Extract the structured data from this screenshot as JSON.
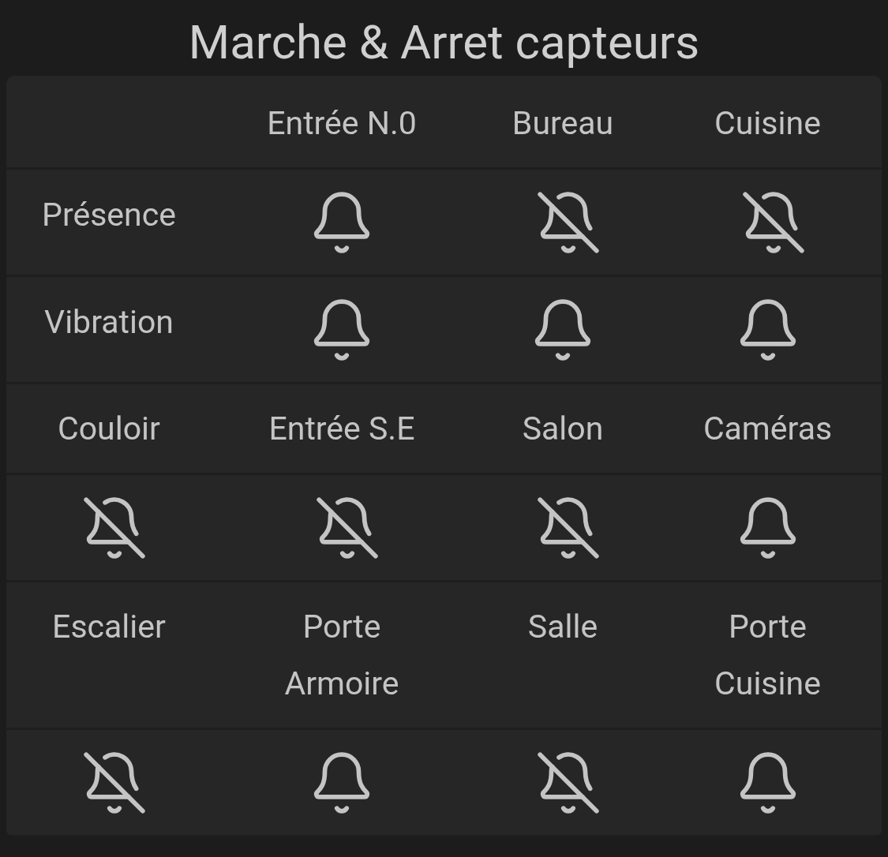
{
  "title": "Marche & Arret capteurs",
  "rows": [
    {
      "kind": "labels",
      "cells": [
        "Entrée N.0",
        "Bureau",
        "Cuisine"
      ]
    },
    {
      "kind": "bells",
      "label": "Présence",
      "alarms": [
        true,
        false,
        false
      ]
    },
    {
      "kind": "bells",
      "label": "Vibration",
      "alarms": [
        true,
        true,
        true
      ]
    },
    {
      "kind": "labels",
      "cells": [
        "Couloir",
        "Entrée S.E",
        "Salon",
        "Caméras"
      ]
    },
    {
      "kind": "bells",
      "alarms": [
        false,
        false,
        false,
        true
      ]
    },
    {
      "kind": "labels",
      "cells": [
        "Escalier",
        "Porte Armoire",
        "Salle",
        "Porte Cuisine"
      ]
    },
    {
      "kind": "bells",
      "alarms": [
        false,
        true,
        false,
        true
      ]
    }
  ]
}
